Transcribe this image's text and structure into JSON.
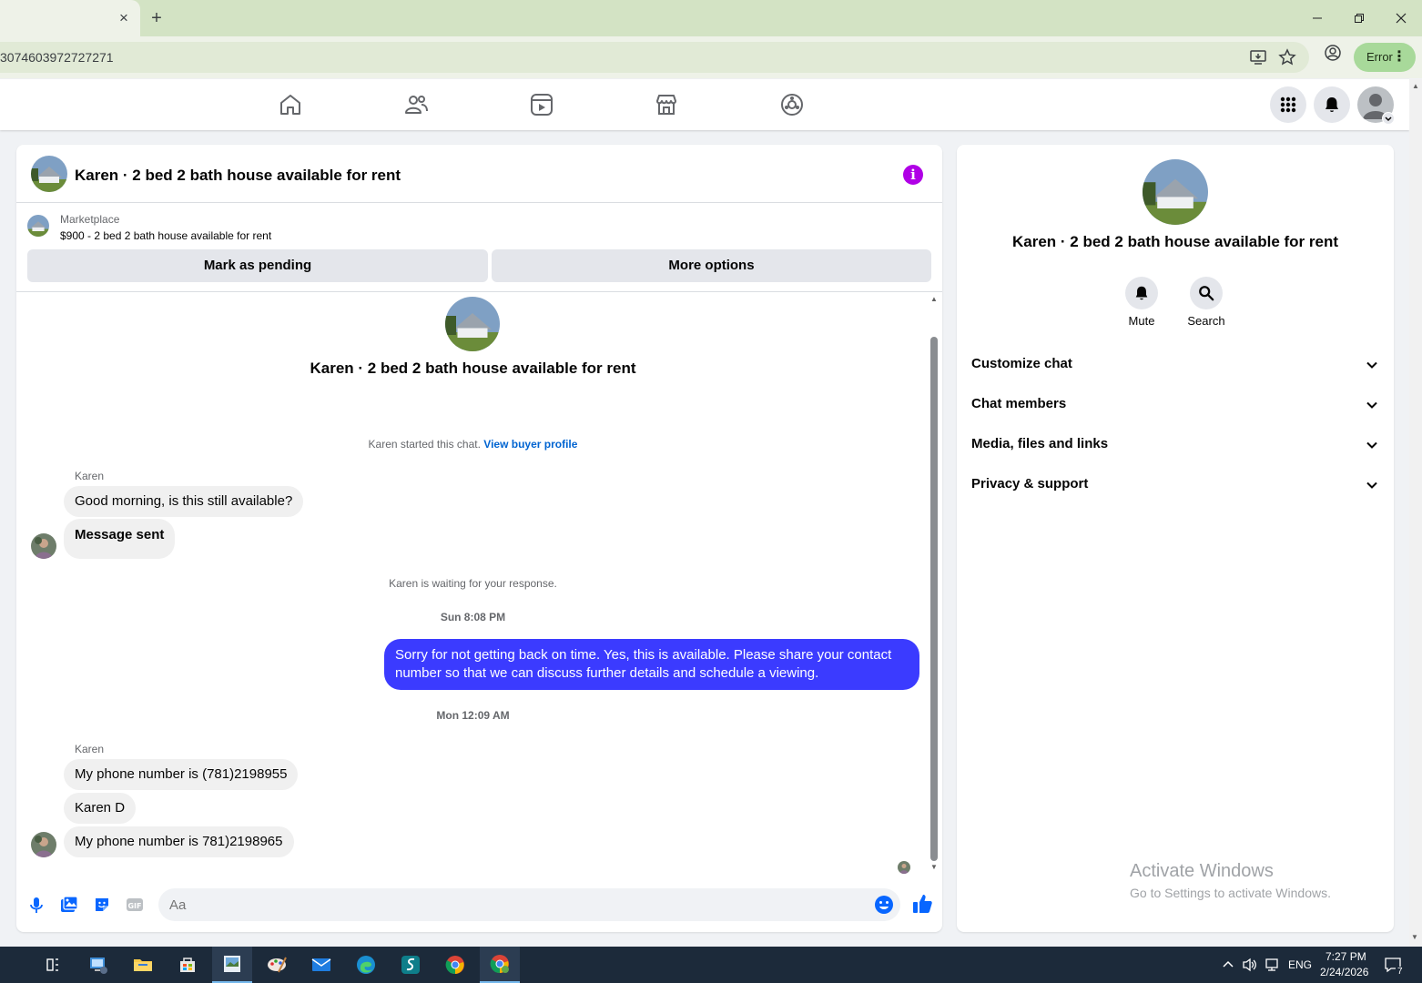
{
  "browser": {
    "url": "3074603972727271",
    "tab_close": "×",
    "new_tab": "+",
    "profile_status": "Error"
  },
  "chat": {
    "header_title": "Karen · 2 bed 2 bath house available for rent",
    "marketplace_label": "Marketplace",
    "listing": "$900 - 2 bed 2 bath house available for rent",
    "mark_pending_label": "Mark as pending",
    "more_options_label": "More options",
    "intro_title": "Karen · 2 bed 2 bath house available for rent",
    "started_text": "Karen started this chat.",
    "view_profile_link": "View buyer profile",
    "waiting_text": "Karen is waiting for your response.",
    "timestamp_1": "Sun 8:08 PM",
    "timestamp_2": "Mon 12:09 AM",
    "sender_name": "Karen",
    "messages_in_1": [
      "Good morning, is this still available?",
      "Message sent"
    ],
    "message_out": "Sorry for not getting back on time. Yes, this is available. Please share your contact number so that we can discuss further details and schedule a viewing.",
    "messages_in_2": [
      "My phone number is (781)2198955",
      "Karen D",
      "My phone number is 781)2198965"
    ],
    "composer_placeholder": "Aa"
  },
  "side": {
    "title": "Karen · 2 bed 2 bath house available for rent",
    "mute_label": "Mute",
    "search_label": "Search",
    "sections": [
      "Customize chat",
      "Chat members",
      "Media, files and links",
      "Privacy & support"
    ]
  },
  "watermark": {
    "line1": "Activate Windows",
    "line2": "Go to Settings to activate Windows."
  },
  "taskbar": {
    "language": "ENG",
    "time": "7:27 PM",
    "date": "2/24/2026",
    "notifications": "7"
  },
  "colors": {
    "accent": "#3b3bff",
    "info": "#b000e6",
    "link": "#0064d1",
    "like": "#0866ff"
  }
}
